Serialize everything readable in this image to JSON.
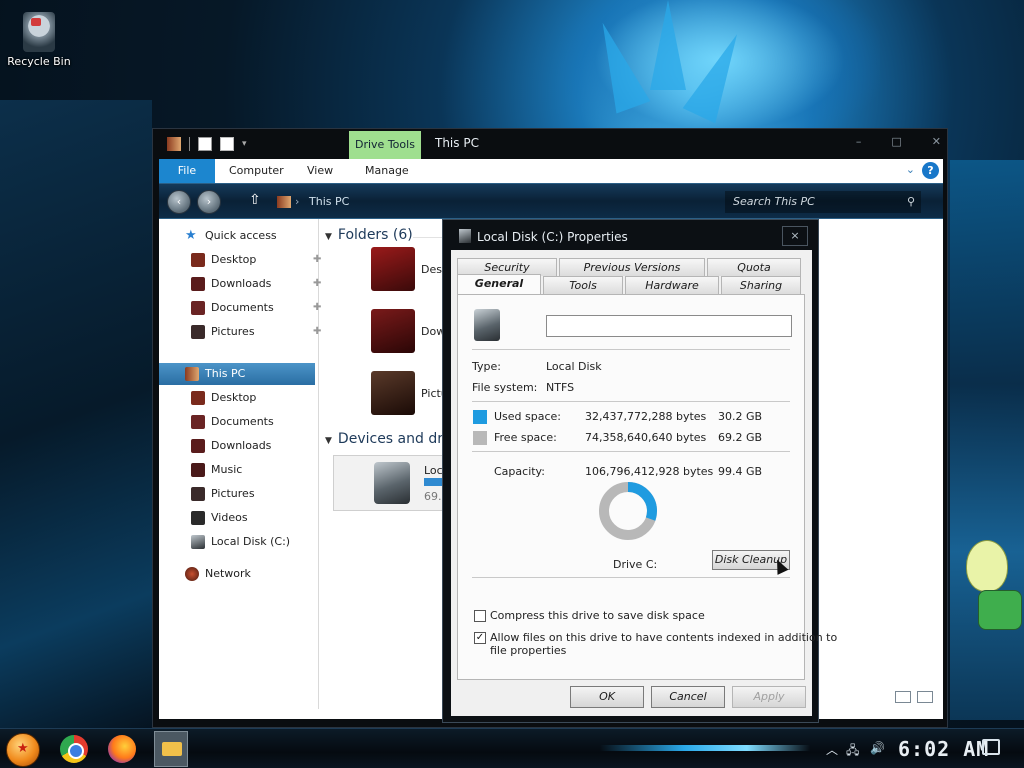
{
  "desktop": {
    "recycle_bin_label": "Recycle Bin"
  },
  "explorer": {
    "context_tab": "Drive Tools",
    "window_title": "This PC",
    "ribbon_tabs": [
      "File",
      "Computer",
      "View",
      "Manage"
    ],
    "address_path": "This PC",
    "search_placeholder": "Search This PC",
    "nav": {
      "quick_access": "Quick access",
      "quick_items": [
        "Desktop",
        "Downloads",
        "Documents",
        "Pictures"
      ],
      "this_pc": "This PC",
      "pc_items": [
        "Desktop",
        "Documents",
        "Downloads",
        "Music",
        "Pictures",
        "Videos",
        "Local Disk (C:)"
      ],
      "network": "Network"
    },
    "folders_header": "Folders (6)",
    "folder_labels": [
      "Desk",
      "Dow",
      "Pictu"
    ],
    "devices_header": "Devices and drive",
    "drive_tile": {
      "name": "Loca",
      "free_text": "69.",
      "used_fraction": 0.3
    }
  },
  "dialog": {
    "title": "Local Disk (C:) Properties",
    "close_label": "×",
    "tabs_row1": [
      "Security",
      "Previous Versions",
      "Quota"
    ],
    "tabs_row2": [
      "General",
      "Tools",
      "Hardware",
      "Sharing"
    ],
    "active_tab": "General",
    "volume_name": "",
    "type_label": "Type:",
    "type_value": "Local Disk",
    "fs_label": "File system:",
    "fs_value": "NTFS",
    "used_label": "Used space:",
    "used_bytes": "32,437,772,288 bytes",
    "used_gb": "30.2 GB",
    "free_label": "Free space:",
    "free_bytes": "74,358,640,640 bytes",
    "free_gb": "69.2 GB",
    "capacity_label": "Capacity:",
    "capacity_bytes": "106,796,412,928 bytes",
    "capacity_gb": "99.4 GB",
    "used_fraction": 0.304,
    "used_color": "#1f9be0",
    "free_color": "#b8b8b8",
    "drive_label": "Drive C:",
    "cleanup_button": "Disk Cleanup",
    "compress_label": "Compress this drive to save disk space",
    "compress_checked": false,
    "index_label_line1": "Allow files on this drive to have contents indexed in addition to",
    "index_label_line2": "file properties",
    "index_checked": true,
    "ok_button": "OK",
    "cancel_button": "Cancel",
    "apply_button": "Apply"
  },
  "taskbar": {
    "clock": "6:02 AM"
  }
}
